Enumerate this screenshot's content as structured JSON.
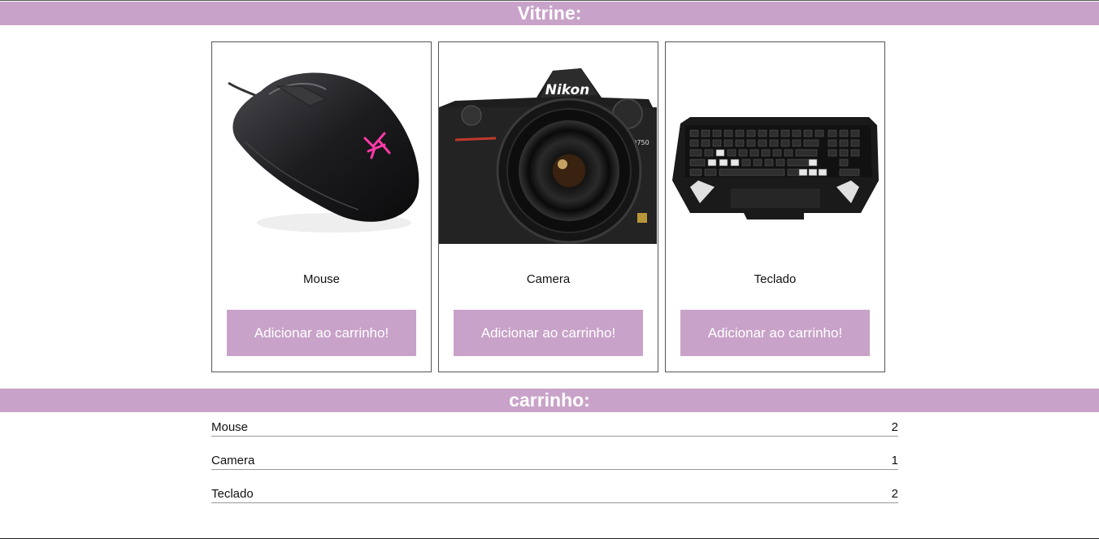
{
  "vitrine": {
    "title": "Vitrine:",
    "products": [
      {
        "name": "Mouse",
        "button_label": "Adicionar ao carrinho!",
        "image_icon": "mouse-icon"
      },
      {
        "name": "Camera",
        "button_label": "Adicionar ao carrinho!",
        "image_icon": "camera-icon",
        "image_brand_text": "Nikon",
        "image_model_text": "D750"
      },
      {
        "name": "Teclado",
        "button_label": "Adicionar ao carrinho!",
        "image_icon": "keyboard-icon"
      }
    ]
  },
  "carrinho": {
    "title": "carrinho:",
    "items": [
      {
        "name": "Mouse",
        "quantity": "2"
      },
      {
        "name": "Camera",
        "quantity": "1"
      },
      {
        "name": "Teclado",
        "quantity": "2"
      }
    ]
  },
  "colors": {
    "accent": "#c8a2c8",
    "header_text": "#ffffff",
    "border": "#555555"
  }
}
